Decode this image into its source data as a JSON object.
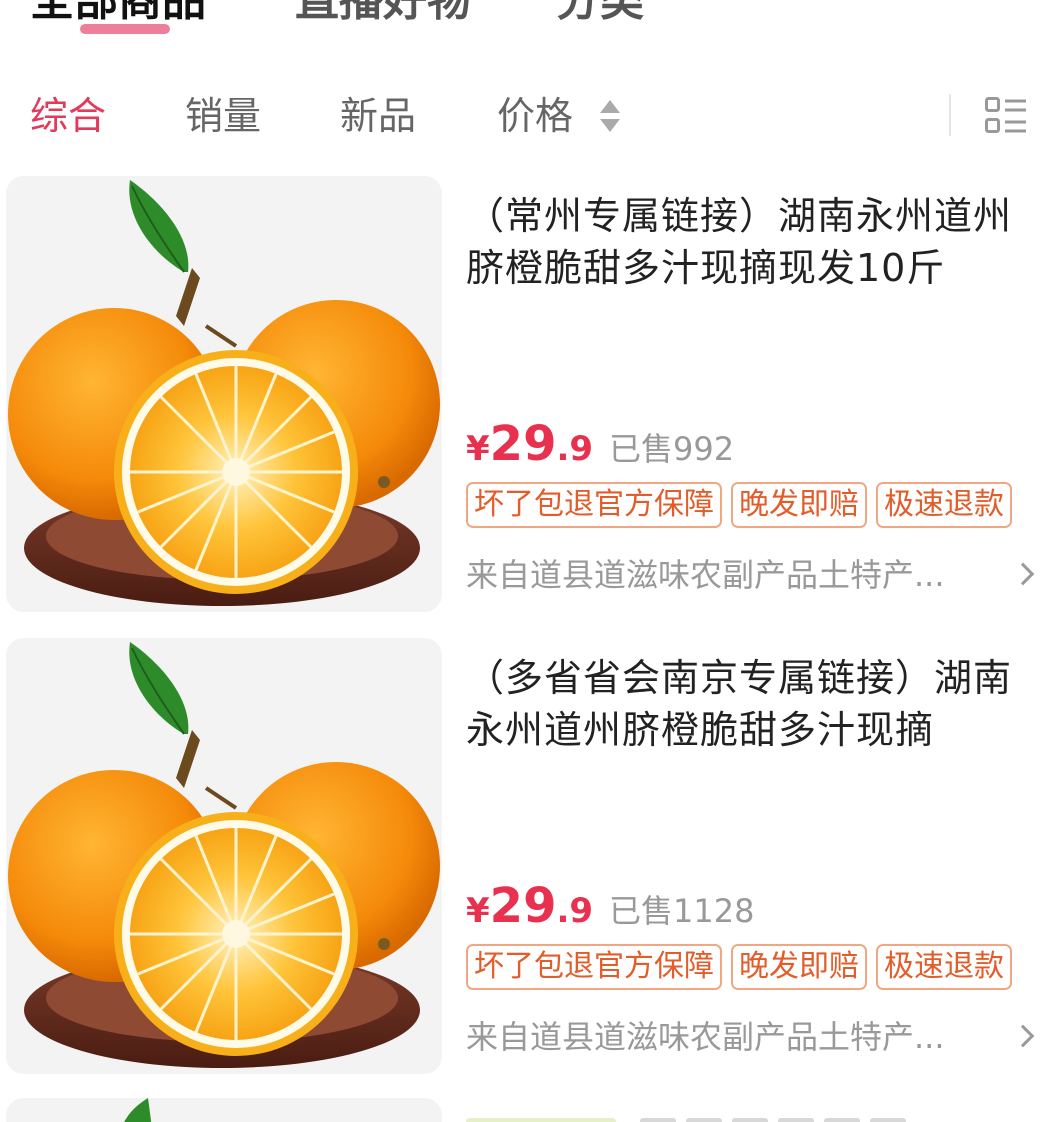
{
  "top_tabs": {
    "all_products": "全部商品",
    "live_goods": "直播好物",
    "category": "分类"
  },
  "sort_bar": {
    "composite": "综合",
    "sales": "销量",
    "new": "新品",
    "price": "价格",
    "layout_icon": "list-layout-icon",
    "sort_icon": "sort-updown-icon"
  },
  "colors": {
    "accent": "#e33a5c",
    "price": "#e8304f",
    "tag_text": "#e35d2a",
    "tag_border": "#f0a884"
  },
  "products": [
    {
      "title": "（常州专属链接）湖南永州道州脐橙脆甜多汁现摘现发10斤",
      "currency": "¥",
      "price_int": "29",
      "price_dec": ".9",
      "sold": "已售992",
      "tags": [
        "坏了包退官方保障",
        "晚发即赔",
        "极速退款"
      ],
      "shop": "来自道县道滋味农副产品土特产...",
      "image": "orange-product-image"
    },
    {
      "title": "（多省省会南京专属链接）湖南永州道州脐橙脆甜多汁现摘",
      "currency": "¥",
      "price_int": "29",
      "price_dec": ".9",
      "sold": "已售1128",
      "tags": [
        "坏了包退官方保障",
        "晚发即赔",
        "极速退款"
      ],
      "shop": "来自道县道滋味农副产品土特产...",
      "image": "orange-product-image"
    }
  ]
}
